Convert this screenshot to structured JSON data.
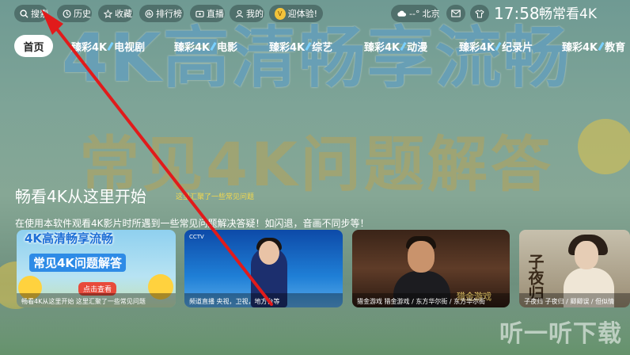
{
  "background": {
    "big_title_1": "4K高清畅享流畅",
    "big_title_2": "常见4K问题解答",
    "watermark": "听一听下载"
  },
  "topbar": {
    "search_label": "搜索",
    "history_label": "历史",
    "favorites_label": "收藏",
    "ranking_label": "排行榜",
    "live_label": "直播",
    "mine_label": "我的",
    "vip_label": "迎体验!",
    "weather_temp": "--°",
    "weather_city": "北京",
    "clock": "17:58",
    "brand": "畅常看4K"
  },
  "tabs": [
    {
      "label": "首页",
      "active": true
    },
    {
      "label_a": "臻彩4K",
      "label_b": "电视剧"
    },
    {
      "label_a": "臻彩4K",
      "label_b": "电影"
    },
    {
      "label_a": "臻彩4K",
      "label_b": "综艺"
    },
    {
      "label_a": "臻彩4K",
      "label_b": "动漫"
    },
    {
      "label_a": "臻彩4K",
      "label_b": "纪录片"
    },
    {
      "label_a": "臻彩4K",
      "label_b": "教育"
    }
  ],
  "section": {
    "title": "畅看4K从这里开始",
    "subtitle": "这里汇聚了一些常见问题",
    "description": "在使用本软件观看4K影片时所遇到一些常见问题解决答疑！如闪退，音画不同步等！"
  },
  "cards": [
    {
      "title_1": "4K高清畅享流畅",
      "title_2": "常见4K问题解答",
      "button": "点击查看",
      "caption": "畅看4K从这里开始    这里汇聚了一些常见问题"
    },
    {
      "logo": "CCTV",
      "caption": "频道直播    央视，卫视，地方台等"
    },
    {
      "overlay_title": "猎金游戏",
      "caption": "猎金游戏    猎金游戏 / 东方华尔街 / 东方华尔街"
    },
    {
      "overlay_title": "子夜归",
      "caption": "子夜归    子夜归 / 卿卿误 / 但似情"
    }
  ],
  "colors": {
    "accent_yellow": "#f4d84c",
    "arrow_red": "#e11b1b",
    "active_tab_bg": "#ffffff"
  }
}
